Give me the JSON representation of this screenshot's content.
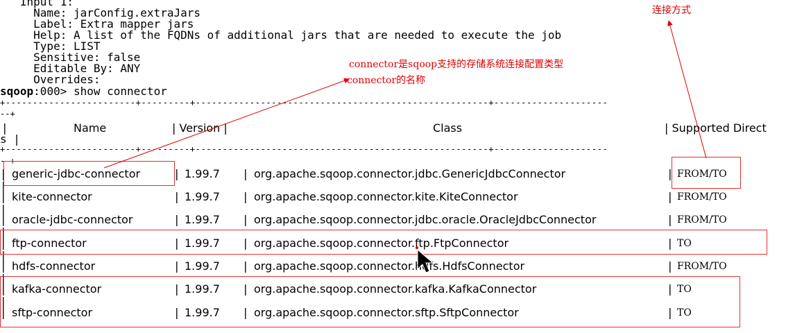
{
  "input_block": {
    "lines": [
      "   Input 1:",
      "     Name: jarConfig.extraJars",
      "     Label: Extra mapper jars",
      "     Help: A list of the FQDNs of additional jars that are needed to execute the job",
      "     Type: LIST",
      "     Sensitive: false",
      "     Editable By: ANY",
      "     Overrides:"
    ]
  },
  "prompt": {
    "name": "sqoop",
    "rest": ":000> show connector"
  },
  "table": {
    "border_top": "+------------------------+---------+------------------------------------------------------+---------------------",
    "border_top_wrap": "--+",
    "header_left": "|",
    "header_name": "Name",
    "header_version": "Version",
    "header_class": "Class",
    "header_supported": "Supported Direct",
    "header_wrap": "s |",
    "border_mid": "+------------------------+---------+------------------------------------------------------+---------------------",
    "border_mid_wrap": "--+",
    "rows": [
      {
        "name": "generic-jdbc-connector",
        "version": "1.99.7",
        "class": "org.apache.sqoop.connector.jdbc.GenericJdbcConnector",
        "direction": "FROM/TO"
      },
      {
        "name": "kite-connector",
        "version": "1.99.7",
        "class": "org.apache.sqoop.connector.kite.KiteConnector",
        "direction": "FROM/TO"
      },
      {
        "name": "oracle-jdbc-connector",
        "version": "1.99.7",
        "class": "org.apache.sqoop.connector.jdbc.oracle.OracleJdbcConnector",
        "direction": "FROM/TO"
      },
      {
        "name": "ftp-connector",
        "version": "1.99.7",
        "class": "org.apache.sqoop.connector.ftp.FtpConnector",
        "direction": "TO"
      },
      {
        "name": "hdfs-connector",
        "version": "1.99.7",
        "class": "org.apache.sqoop.connector.hdfs.HdfsConnector",
        "direction": "FROM/TO"
      },
      {
        "name": "kafka-connector",
        "version": "1.99.7",
        "class": "org.apache.sqoop.connector.kafka.KafkaConnector",
        "direction": "TO"
      },
      {
        "name": "sftp-connector",
        "version": "1.99.7",
        "class": "org.apache.sqoop.connector.sftp.SftpConnector",
        "direction": "TO"
      }
    ],
    "row_separator": "|"
  },
  "annotations": {
    "connection_method": "连接方式",
    "connector_line1": "connector是sqoop支持的存储系统连接配置类型",
    "connector_line2": "connector的名称"
  },
  "colors": {
    "annotation_red": "#e00000",
    "text": "#000000",
    "background": "#ffffff"
  },
  "icons": {
    "cursor": "mouse-pointer-icon"
  }
}
